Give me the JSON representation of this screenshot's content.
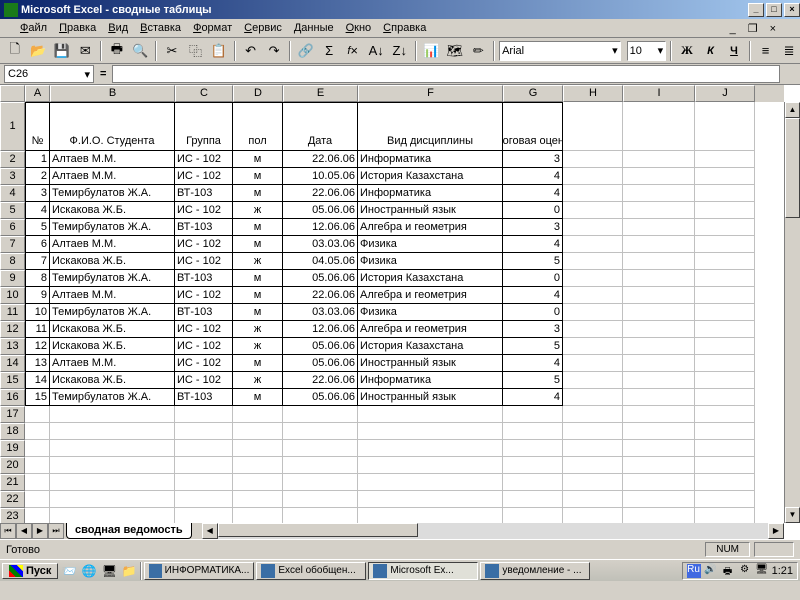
{
  "window": {
    "title": "Microsoft Excel - сводные таблицы"
  },
  "menu": {
    "file": "Файл",
    "edit": "Правка",
    "view": "Вид",
    "insert": "Вставка",
    "format": "Формат",
    "tools": "Сервис",
    "data": "Данные",
    "window": "Окно",
    "help": "Справка"
  },
  "font": {
    "name": "Arial",
    "size": "10"
  },
  "namebox": "C26",
  "columns": [
    "A",
    "B",
    "C",
    "D",
    "E",
    "F",
    "G",
    "H",
    "I",
    "J"
  ],
  "headers": {
    "A": "№",
    "B": "Ф.И.О. Студента",
    "C": "Группа",
    "D": "пол",
    "E": "Дата",
    "F": "Вид дисциплины",
    "G": "Итоговая оценка"
  },
  "rows": [
    {
      "n": "1",
      "fio": "Алтаев М.М.",
      "grp": "ИС - 102",
      "sex": "м",
      "date": "22.06.06",
      "disc": "Информатика",
      "mark": "3"
    },
    {
      "n": "2",
      "fio": "Алтаев М.М.",
      "grp": "ИС - 102",
      "sex": "м",
      "date": "10.05.06",
      "disc": "История Казахстана",
      "mark": "4"
    },
    {
      "n": "3",
      "fio": "Темирбулатов Ж.А.",
      "grp": "ВТ-103",
      "sex": "м",
      "date": "22.06.06",
      "disc": "Информатика",
      "mark": "4"
    },
    {
      "n": "4",
      "fio": "Искакова Ж.Б.",
      "grp": "ИС - 102",
      "sex": "ж",
      "date": "05.06.06",
      "disc": "Иностранный язык",
      "mark": "0"
    },
    {
      "n": "5",
      "fio": "Темирбулатов Ж.А.",
      "grp": "ВТ-103",
      "sex": "м",
      "date": "12.06.06",
      "disc": "Алгебра и геометрия",
      "mark": "3"
    },
    {
      "n": "6",
      "fio": "Алтаев М.М.",
      "grp": "ИС - 102",
      "sex": "м",
      "date": "03.03.06",
      "disc": "Физика",
      "mark": "4"
    },
    {
      "n": "7",
      "fio": "Искакова Ж.Б.",
      "grp": "ИС - 102",
      "sex": "ж",
      "date": "04.05.06",
      "disc": "Физика",
      "mark": "5"
    },
    {
      "n": "8",
      "fio": "Темирбулатов Ж.А.",
      "grp": "ВТ-103",
      "sex": "м",
      "date": "05.06.06",
      "disc": "История Казахстана",
      "mark": "0"
    },
    {
      "n": "9",
      "fio": "Алтаев М.М.",
      "grp": "ИС - 102",
      "sex": "м",
      "date": "22.06.06",
      "disc": "Алгебра и геометрия",
      "mark": "4"
    },
    {
      "n": "10",
      "fio": "Темирбулатов Ж.А.",
      "grp": "ВТ-103",
      "sex": "м",
      "date": "03.03.06",
      "disc": "Физика",
      "mark": "0"
    },
    {
      "n": "11",
      "fio": "Искакова Ж.Б.",
      "grp": "ИС - 102",
      "sex": "ж",
      "date": "12.06.06",
      "disc": "Алгебра и геометрия",
      "mark": "3"
    },
    {
      "n": "12",
      "fio": "Искакова Ж.Б.",
      "grp": "ИС - 102",
      "sex": "ж",
      "date": "05.06.06",
      "disc": "История Казахстана",
      "mark": "5"
    },
    {
      "n": "13",
      "fio": "Алтаев М.М.",
      "grp": "ИС - 102",
      "sex": "м",
      "date": "05.06.06",
      "disc": "Иностранный язык",
      "mark": "4"
    },
    {
      "n": "14",
      "fio": "Искакова Ж.Б.",
      "grp": "ИС - 102",
      "sex": "ж",
      "date": "22.06.06",
      "disc": "Информатика",
      "mark": "5"
    },
    {
      "n": "15",
      "fio": "Темирбулатов Ж.А.",
      "grp": "ВТ-103",
      "sex": "м",
      "date": "05.06.06",
      "disc": "Иностранный язык",
      "mark": "4"
    }
  ],
  "sheet": "сводная ведомость",
  "status": {
    "ready": "Готово",
    "num": "NUM"
  },
  "taskbar": {
    "start": "Пуск",
    "btns": [
      {
        "label": "ИНФОРМАТИКА...",
        "active": false
      },
      {
        "label": "Excel обобщен...",
        "active": false
      },
      {
        "label": "Microsoft Ex...",
        "active": true
      },
      {
        "label": "уведомление - ...",
        "active": false
      }
    ],
    "lang": "Ru",
    "time": "1:21"
  }
}
